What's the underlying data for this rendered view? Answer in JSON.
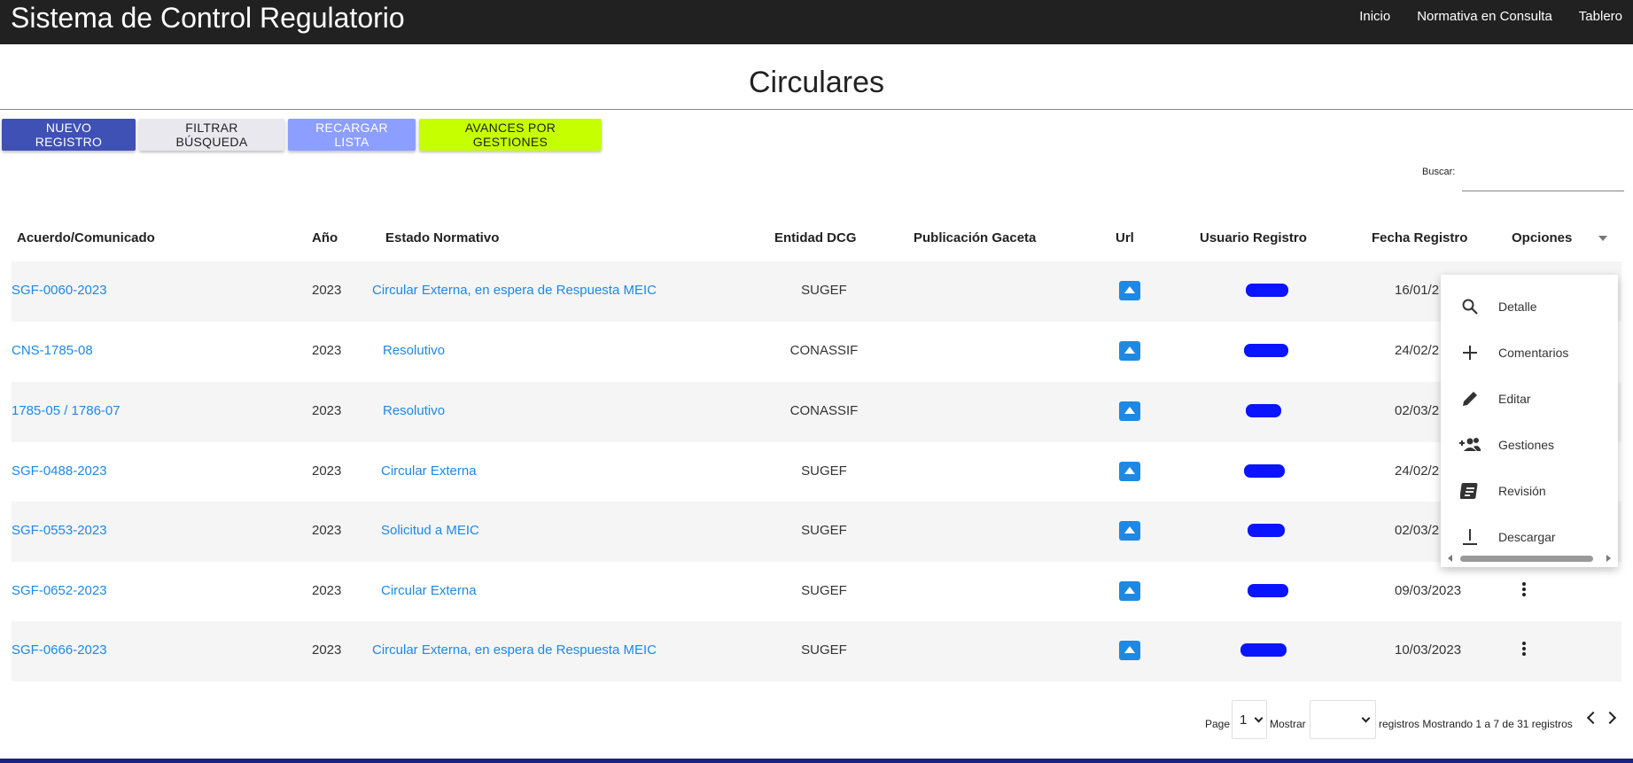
{
  "header": {
    "app_title": "Sistema de Control Regulatorio",
    "nav": [
      "Inicio",
      "Normativa en Consulta",
      "Tablero"
    ]
  },
  "page": {
    "title": "Circulares"
  },
  "toolbar": {
    "new_label": "NUEVO REGISTRO",
    "filter_label": "FILTRAR BÚSQUEDA",
    "reload_label": "RECARGAR LISTA",
    "advances_label": "AVANCES POR GESTIONES"
  },
  "search": {
    "label": "Buscar:",
    "value": "",
    "placeholder": ""
  },
  "table": {
    "headers": [
      "Acuerdo/Comunicado",
      "Año",
      "Estado Normativo",
      "Entidad DCG",
      "Publicación Gaceta",
      "Url",
      "Usuario Registro",
      "Fecha Registro",
      "Opciones"
    ],
    "rows": [
      {
        "acuerdo": "SGF-0060-2023",
        "anio": "2023",
        "estado": "Circular Externa, en espera de Respuesta MEIC",
        "entidad": "SUGEF",
        "gaceta": "",
        "fecha": "16/01/2"
      },
      {
        "acuerdo": "CNS-1785-08",
        "anio": "2023",
        "estado": "Resolutivo",
        "entidad": "CONASSIF",
        "gaceta": "",
        "fecha": "24/02/2"
      },
      {
        "acuerdo": "1785-05 / 1786-07",
        "anio": "2023",
        "estado": "Resolutivo",
        "entidad": "CONASSIF",
        "gaceta": "",
        "fecha": "02/03/2"
      },
      {
        "acuerdo": "SGF-0488-2023",
        "anio": "2023",
        "estado": "Circular Externa",
        "entidad": "SUGEF",
        "gaceta": "",
        "fecha": "24/02/2"
      },
      {
        "acuerdo": "SGF-0553-2023",
        "anio": "2023",
        "estado": "Solicitud a MEIC",
        "entidad": "SUGEF",
        "gaceta": "",
        "fecha": "02/03/2"
      },
      {
        "acuerdo": "SGF-0652-2023",
        "anio": "2023",
        "estado": "Circular Externa",
        "entidad": "SUGEF",
        "gaceta": "",
        "fecha": "09/03/2023"
      },
      {
        "acuerdo": "SGF-0666-2023",
        "anio": "2023",
        "estado": "Circular Externa, en espera de Respuesta MEIC",
        "entidad": "SUGEF",
        "gaceta": "",
        "fecha": "10/03/2023"
      }
    ]
  },
  "options_menu": {
    "items": [
      {
        "label": "Detalle",
        "icon": "search-icon"
      },
      {
        "label": "Comentarios",
        "icon": "plus-icon"
      },
      {
        "label": "Editar",
        "icon": "pencil-icon"
      },
      {
        "label": "Gestiones",
        "icon": "group-add-icon"
      },
      {
        "label": "Revisión",
        "icon": "article-icon"
      },
      {
        "label": "Descargar",
        "icon": "download-icon"
      }
    ]
  },
  "pagination": {
    "page_label": "Page",
    "page_value": "1",
    "show_label": "Mostrar",
    "show_value": "",
    "summary": "registros Mostrando 1 a 7 de 31 registros"
  },
  "colors": {
    "topbar": "#212121",
    "primary": "#3f51b5",
    "link": "#1e88e5",
    "lime": "#c6ff00",
    "reload": "#8c9eff"
  }
}
